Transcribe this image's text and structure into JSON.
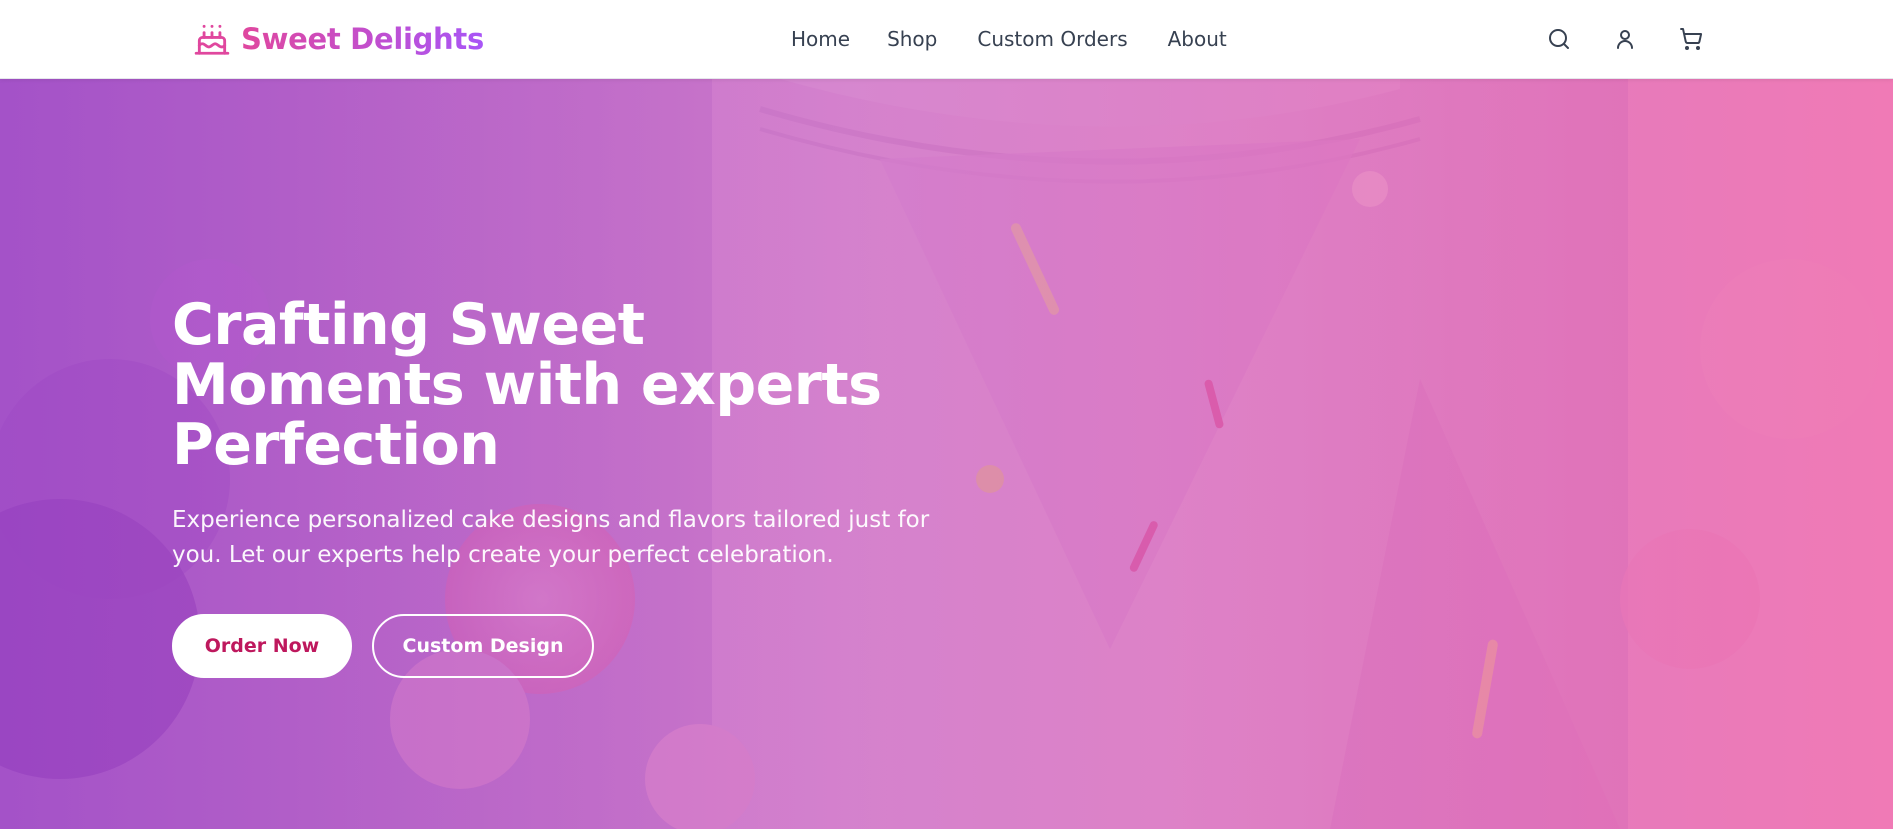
{
  "brand": {
    "name": "Sweet Delights",
    "icon": "cake-icon",
    "color": "#e0479e"
  },
  "nav": {
    "items": [
      {
        "label": "Home"
      },
      {
        "label": "Shop"
      },
      {
        "label": "Custom Orders"
      },
      {
        "label": "About"
      }
    ]
  },
  "actions": {
    "search_icon": "search-icon",
    "account_icon": "user-icon",
    "cart_icon": "cart-icon"
  },
  "hero": {
    "title": "Crafting Sweet Moments with experts Perfection",
    "subtitle": "Experience personalized cake designs and flavors tailored just for you. Let our experts help create your perfect celebration.",
    "primary_button": "Order Now",
    "secondary_button": "Custom Design",
    "background_image": "pink-layered-cake-with-flowers",
    "overlay_colors": [
      "#9333c8",
      "#ec4899"
    ]
  }
}
